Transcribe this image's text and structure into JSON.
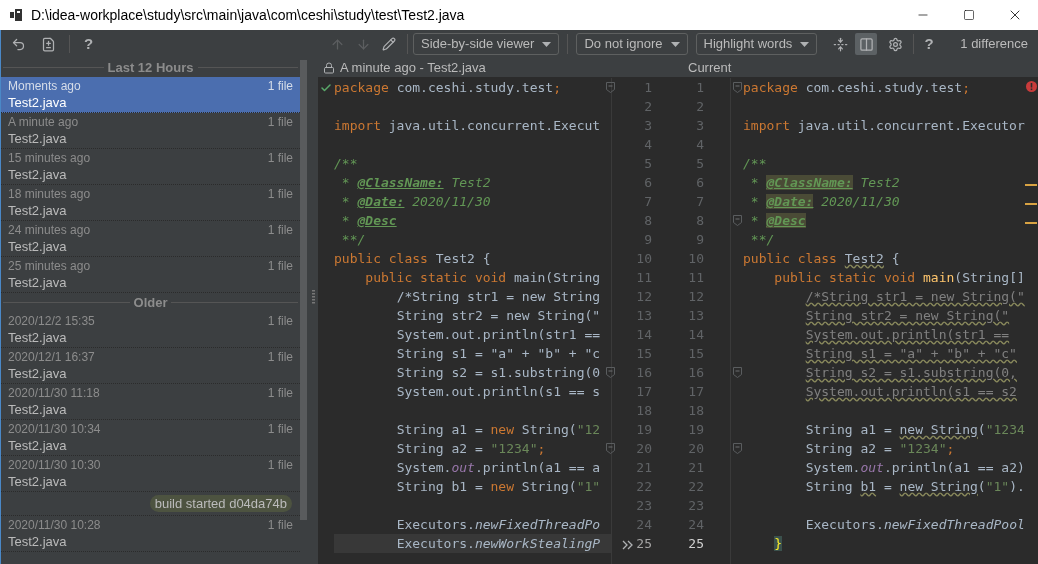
{
  "window": {
    "title": "D:\\idea-workplace\\study\\src\\main\\java\\com\\ceshi\\study\\test\\Test2.java"
  },
  "history_toolbar": {
    "help": "?"
  },
  "diff_toolbar": {
    "navigation": [
      {
        "kind": "up",
        "disabled": true
      },
      {
        "kind": "down",
        "disabled": true
      }
    ],
    "dropdowns": [
      "Side-by-side viewer",
      "Do not ignore",
      "Highlight words"
    ],
    "toggles": [
      {
        "kind": "collapse",
        "selected": false
      },
      {
        "kind": "sync-scroll",
        "selected": true
      }
    ],
    "help": "?",
    "difference_count": "1 difference"
  },
  "history": {
    "items": [
      {
        "kind": "section",
        "label": "Last 12 Hours"
      },
      {
        "kind": "entry",
        "time": "Moments ago",
        "count": "1 file",
        "file": "Test2.java",
        "selected": true
      },
      {
        "kind": "entry",
        "time": "A minute ago",
        "count": "1 file",
        "file": "Test2.java",
        "selected": false
      },
      {
        "kind": "entry",
        "time": "15 minutes ago",
        "count": "1 file",
        "file": "Test2.java",
        "selected": false
      },
      {
        "kind": "entry",
        "time": "18 minutes ago",
        "count": "1 file",
        "file": "Test2.java",
        "selected": false
      },
      {
        "kind": "entry",
        "time": "24 minutes ago",
        "count": "1 file",
        "file": "Test2.java",
        "selected": false
      },
      {
        "kind": "entry",
        "time": "25 minutes ago",
        "count": "1 file",
        "file": "Test2.java",
        "selected": false
      },
      {
        "kind": "section",
        "label": "Older"
      },
      {
        "kind": "entry",
        "time": "2020/12/2 15:35",
        "count": "1 file",
        "file": "Test2.java",
        "selected": false
      },
      {
        "kind": "entry",
        "time": "2020/12/1 16:37",
        "count": "1 file",
        "file": "Test2.java",
        "selected": false
      },
      {
        "kind": "entry",
        "time": "2020/11/30 11:18",
        "count": "1 file",
        "file": "Test2.java",
        "selected": false
      },
      {
        "kind": "entry",
        "time": "2020/11/30 10:34",
        "count": "1 file",
        "file": "Test2.java",
        "selected": false
      },
      {
        "kind": "entry",
        "time": "2020/11/30 10:30",
        "count": "1 file",
        "file": "Test2.java",
        "selected": false
      },
      {
        "kind": "label",
        "label": "build started d04da74b"
      },
      {
        "kind": "entry",
        "time": "2020/11/30 10:28",
        "count": "1 file",
        "file": "Test2.java",
        "selected": false
      }
    ]
  },
  "left_editor": {
    "title": "A minute ago - Test2.java",
    "lines": [
      {
        "s": [
          {
            "kind": "kw",
            "text": "package"
          },
          {
            "kind": "p",
            "text": " com.ceshi.study.test"
          },
          {
            "kind": "kw",
            "text": ";"
          }
        ],
        "caret": false
      },
      {
        "caret": false
      },
      {
        "s": [
          {
            "kind": "kw",
            "text": "import"
          },
          {
            "kind": "p",
            "text": " java.util.concurrent.Execut"
          }
        ],
        "caret": false
      },
      {
        "caret": false
      },
      {
        "s": [
          {
            "kind": "doc",
            "text": "/**"
          }
        ],
        "caret": false
      },
      {
        "s": [
          {
            "kind": "doc",
            "text": " * "
          },
          {
            "kind": "tag",
            "text": "@ClassName:"
          },
          {
            "kind": "doc",
            "text": " Test2"
          }
        ],
        "caret": false
      },
      {
        "s": [
          {
            "kind": "doc",
            "text": " * "
          },
          {
            "kind": "tag",
            "text": "@Date:"
          },
          {
            "kind": "doc",
            "text": " 2020/11/30"
          }
        ],
        "caret": false
      },
      {
        "s": [
          {
            "kind": "doc",
            "text": " * "
          },
          {
            "kind": "tag",
            "text": "@Desc"
          }
        ],
        "caret": false
      },
      {
        "s": [
          {
            "kind": "doc",
            "text": " **/"
          }
        ],
        "caret": false
      },
      {
        "s": [
          {
            "kind": "kw",
            "text": "public class"
          },
          {
            "kind": "p",
            "text": " Test2 {"
          }
        ],
        "caret": false
      },
      {
        "s": [
          {
            "kind": "kw",
            "text": "    public static void"
          },
          {
            "kind": "p",
            "text": " main(String"
          }
        ],
        "caret": false
      },
      {
        "s": [
          {
            "kind": "p",
            "text": "        /*String str1 = new String"
          }
        ],
        "caret": false
      },
      {
        "s": [
          {
            "kind": "p",
            "text": "        String str2 = new String(\""
          }
        ],
        "caret": false
      },
      {
        "s": [
          {
            "kind": "p",
            "text": "        System.out.println(str1 =="
          }
        ],
        "caret": false
      },
      {
        "s": [
          {
            "kind": "p",
            "text": "        String s1 = \"a\" + \"b\" + \"c"
          }
        ],
        "caret": false
      },
      {
        "s": [
          {
            "kind": "p",
            "text": "        String s2 = s1.substring(0"
          }
        ],
        "caret": false
      },
      {
        "s": [
          {
            "kind": "p",
            "text": "        System.out.println(s1 == s"
          }
        ],
        "caret": false
      },
      {
        "caret": false
      },
      {
        "s": [
          {
            "kind": "p",
            "text": "        String a1 = "
          },
          {
            "kind": "kw",
            "text": "new"
          },
          {
            "kind": "p",
            "text": " String("
          },
          {
            "kind": "str",
            "text": "\"12"
          }
        ],
        "caret": false
      },
      {
        "s": [
          {
            "kind": "p",
            "text": "        String a2 = "
          },
          {
            "kind": "str",
            "text": "\"1234\""
          },
          {
            "kind": "kw",
            "text": ";"
          }
        ],
        "caret": false
      },
      {
        "s": [
          {
            "kind": "p",
            "text": "        System."
          },
          {
            "kind": "fld",
            "text": "out"
          },
          {
            "kind": "p",
            "text": ".println(a1 == a"
          }
        ],
        "caret": false
      },
      {
        "s": [
          {
            "kind": "p",
            "text": "        String b1 = "
          },
          {
            "kind": "kw",
            "text": "new"
          },
          {
            "kind": "p",
            "text": " String("
          },
          {
            "kind": "str",
            "text": "\"1\""
          }
        ],
        "caret": false
      },
      {
        "caret": false
      },
      {
        "s": [
          {
            "kind": "p",
            "text": "        Executors."
          },
          {
            "kind": "mi",
            "text": "newFixedThreadPo"
          }
        ],
        "caret": false
      },
      {
        "s": [
          {
            "kind": "p",
            "text": "        Executors."
          },
          {
            "kind": "mi",
            "text": "newWorkStealingP"
          }
        ],
        "caret": true
      }
    ]
  },
  "gutter": {
    "left_numbers": [
      "1",
      "2",
      "3",
      "4",
      "5",
      "6",
      "7",
      "8",
      "9",
      "10",
      "11",
      "12",
      "13",
      "14",
      "15",
      "16",
      "17",
      "18",
      "19",
      "20",
      "21",
      "22",
      "23",
      "24",
      "25"
    ],
    "right_numbers": [
      "1",
      "2",
      "3",
      "4",
      "5",
      "6",
      "7",
      "8",
      "9",
      "10",
      "11",
      "12",
      "13",
      "14",
      "15",
      "16",
      "17",
      "18",
      "19",
      "20",
      "21",
      "22",
      "23",
      "24",
      "25"
    ]
  },
  "right_editor": {
    "title": "Current",
    "lines": [
      {
        "s": [
          {
            "kind": "kw",
            "text": "package"
          },
          {
            "kind": "p",
            "text": " com.ceshi.study.test"
          },
          {
            "kind": "kw",
            "text": ";"
          }
        ],
        "caret": false
      },
      {
        "caret": false
      },
      {
        "s": [
          {
            "kind": "kw",
            "text": "import"
          },
          {
            "kind": "p",
            "text": " java.util.concurrent.Executor"
          }
        ],
        "caret": false
      },
      {
        "caret": false
      },
      {
        "s": [
          {
            "kind": "doc",
            "text": "/**"
          }
        ],
        "caret": false
      },
      {
        "s": [
          {
            "kind": "doc",
            "text": " * "
          },
          {
            "kind": "taghl",
            "text": "@ClassName:"
          },
          {
            "kind": "doc",
            "text": " Test2"
          }
        ],
        "caret": false
      },
      {
        "s": [
          {
            "kind": "doc",
            "text": " * "
          },
          {
            "kind": "taghl",
            "text": "@Date:"
          },
          {
            "kind": "doc",
            "text": " 2020/11/30"
          }
        ],
        "caret": false
      },
      {
        "s": [
          {
            "kind": "doc",
            "text": " * "
          },
          {
            "kind": "taghl",
            "text": "@Desc"
          }
        ],
        "caret": false
      },
      {
        "s": [
          {
            "kind": "doc",
            "text": " **/"
          }
        ],
        "caret": false
      },
      {
        "s": [
          {
            "kind": "kw",
            "text": "public class "
          },
          {
            "kind": "warn",
            "text": "Test2"
          },
          {
            "kind": "p",
            "text": " {"
          }
        ],
        "caret": false
      },
      {
        "s": [
          {
            "kind": "kw",
            "text": "    public static void "
          },
          {
            "kind": "fn",
            "text": "main"
          },
          {
            "kind": "p",
            "text": "(String[]"
          }
        ],
        "caret": false
      },
      {
        "s": [
          {
            "kind": "cmw",
            "text": "        /*String str1 = new String(\""
          }
        ],
        "caret": false
      },
      {
        "s": [
          {
            "kind": "cmw",
            "text": "        String str2 = new String(\""
          }
        ],
        "caret": false
      },
      {
        "s": [
          {
            "kind": "cmw",
            "text": "        System.out.println(str1 =="
          }
        ],
        "caret": false
      },
      {
        "s": [
          {
            "kind": "cmw",
            "text": "        String s1 = \"a\" + \"b\" + \"c\""
          }
        ],
        "caret": false
      },
      {
        "s": [
          {
            "kind": "cmw",
            "text": "        String s2 = s1.substring(0,"
          }
        ],
        "caret": false
      },
      {
        "s": [
          {
            "kind": "cmw",
            "text": "        System.out.println(s1 == s2"
          }
        ],
        "caret": false
      },
      {
        "caret": false
      },
      {
        "s": [
          {
            "kind": "p",
            "text": "        String a1 = "
          },
          {
            "kind": "warn",
            "text": "new String"
          },
          {
            "kind": "p",
            "text": "("
          },
          {
            "kind": "str",
            "text": "\"1234"
          }
        ],
        "caret": false
      },
      {
        "s": [
          {
            "kind": "p",
            "text": "        String a2 = "
          },
          {
            "kind": "str",
            "text": "\"1234\""
          },
          {
            "kind": "kw",
            "text": ";"
          }
        ],
        "caret": false
      },
      {
        "s": [
          {
            "kind": "p",
            "text": "        System."
          },
          {
            "kind": "fld",
            "text": "out"
          },
          {
            "kind": "p",
            "text": ".println(a1 == a2)"
          }
        ],
        "caret": false
      },
      {
        "s": [
          {
            "kind": "p",
            "text": "        String "
          },
          {
            "kind": "warn",
            "text": "b1"
          },
          {
            "kind": "p",
            "text": " = "
          },
          {
            "kind": "warn",
            "text": "new String"
          },
          {
            "kind": "p",
            "text": "("
          },
          {
            "kind": "str",
            "text": "\"1\""
          },
          {
            "kind": "p",
            "text": ")."
          }
        ],
        "caret": false
      },
      {
        "caret": false
      },
      {
        "s": [
          {
            "kind": "p",
            "text": "        Executors."
          },
          {
            "kind": "mi",
            "text": "newFixedThreadPool"
          }
        ],
        "caret": false
      },
      {
        "s": [
          {
            "kind": "brace",
            "text": "    }"
          }
        ],
        "caret": false
      }
    ]
  }
}
